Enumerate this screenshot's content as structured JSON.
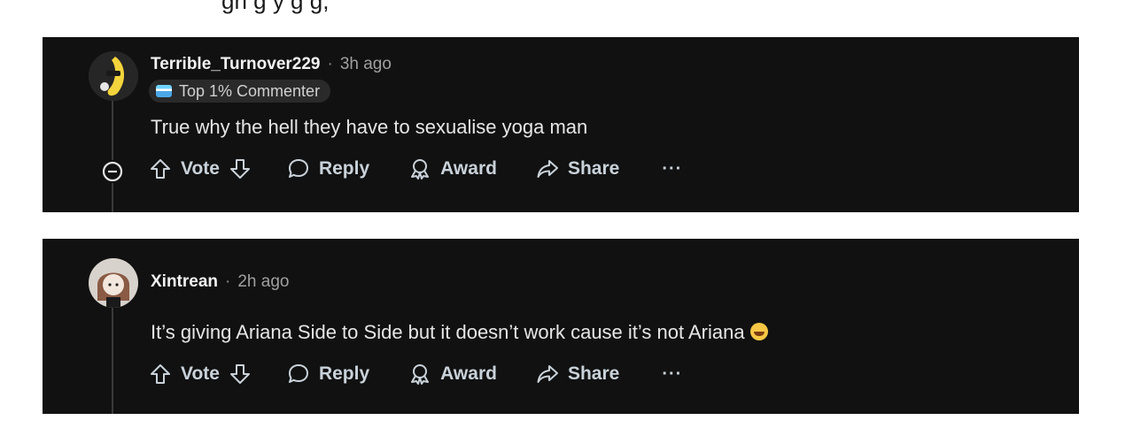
{
  "top_text": "gh                                   g    y     g           g,",
  "comments": [
    {
      "username": "Terrible_Turnover229",
      "separator": "·",
      "time": "3h ago",
      "flair": "Top 1% Commenter",
      "text": "True why the hell they have to sexualise yoga man",
      "actions": {
        "vote": "Vote",
        "reply": "Reply",
        "award": "Award",
        "share": "Share",
        "more": "···"
      }
    },
    {
      "username": "Xintrean",
      "separator": "·",
      "time": "2h ago",
      "text": "It’s giving Ariana Side to Side but it doesn’t work cause it’s not Ariana",
      "actions": {
        "vote": "Vote",
        "reply": "Reply",
        "award": "Award",
        "share": "Share",
        "more": "···"
      }
    }
  ],
  "colors": {
    "card_bg": "#111111",
    "text": "#e6e6e6",
    "muted": "#a0a0a0",
    "action": "#c9d2da",
    "flair_bg": "#2a2a2a"
  },
  "icons": [
    "upvote-icon",
    "downvote-icon",
    "reply-icon",
    "award-icon",
    "share-icon",
    "collapse-icon",
    "more-icon",
    "laugh-emoji-icon"
  ]
}
